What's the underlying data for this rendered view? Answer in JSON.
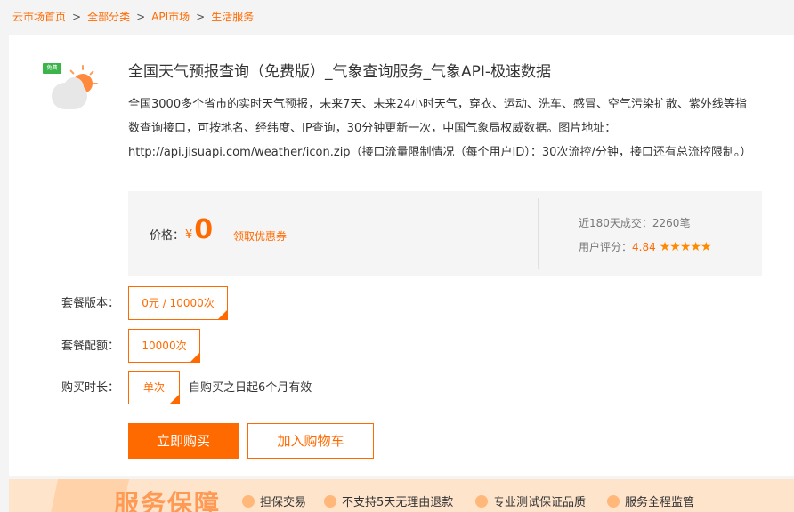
{
  "breadcrumb": {
    "items": [
      "云市场首页",
      "全部分类",
      "API市场",
      "生活服务"
    ],
    "separator": ">"
  },
  "product": {
    "badge": "免费",
    "title": "全国天气预报查询（免费版）_气象查询服务_气象API-极速数据",
    "description": "全国3000多个省市的实时天气预报，未来7天、未来24小时天气，穿衣、运动、洗车、感冒、空气污染扩散、紫外线等指数查询接口，可按地名、经纬度、IP查询，30分钟更新一次，中国气象局权威数据。图片地址：http://api.jisuapi.com/weather/icon.zip（接口流量限制情况（每个用户ID）：30次流控/分钟，接口还有总流控限制。）"
  },
  "price": {
    "label": "价格：",
    "currency": "¥",
    "value": "0",
    "coupon": "领取优惠券",
    "sales": "近180天成交：2260笔",
    "rating_label": "用户评分：",
    "rating_value": "4.84",
    "stars": "★★★★★",
    "rating_stars_count": 5
  },
  "options": {
    "version_label": "套餐版本：",
    "version_value": "0元 / 10000次",
    "quota_label": "套餐配额：",
    "quota_value": "10000次",
    "duration_label": "购买时长：",
    "duration_value": "单次",
    "duration_note": "自购买之日起6个月有效"
  },
  "actions": {
    "buy": "立即购买",
    "cart": "加入购物车"
  },
  "guarantee": {
    "title": "服务保障",
    "items": [
      "担保交易",
      "不支持5天无理由退款",
      "专业测试保证品质",
      "服务全程监管"
    ]
  },
  "colors": {
    "accent": "#ff6a00",
    "badge": "#3bb54a",
    "sun": "#ff8a3d"
  }
}
